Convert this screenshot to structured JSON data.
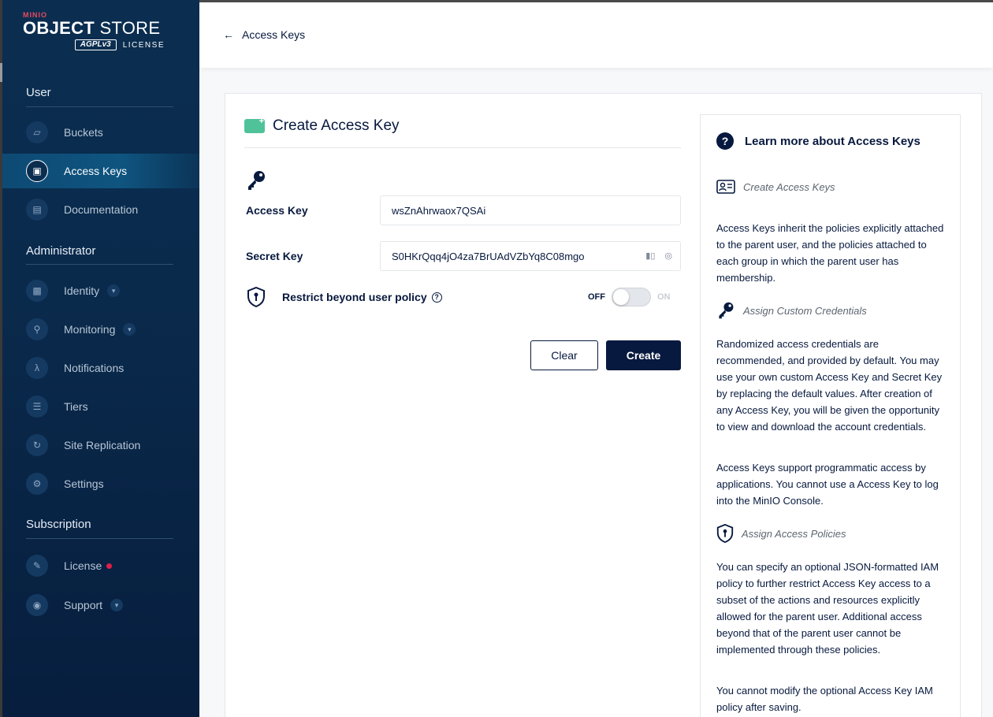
{
  "brand": {
    "minio": "MINIO",
    "store_bold": "OBJECT",
    "store_rest": " STORE",
    "agpl": "AGPLv3",
    "license": "LICENSE"
  },
  "sidebar": {
    "sections": [
      "User",
      "Administrator",
      "Subscription"
    ],
    "user_items": [
      {
        "label": "Buckets",
        "icon": "bucket-icon"
      },
      {
        "label": "Access Keys",
        "icon": "access-key-icon",
        "active": true
      },
      {
        "label": "Documentation",
        "icon": "document-icon"
      }
    ],
    "admin_items": [
      {
        "label": "Identity",
        "icon": "identity-icon",
        "expandable": true
      },
      {
        "label": "Monitoring",
        "icon": "monitoring-icon",
        "expandable": true
      },
      {
        "label": "Notifications",
        "icon": "lambda-icon"
      },
      {
        "label": "Tiers",
        "icon": "tiers-icon"
      },
      {
        "label": "Site Replication",
        "icon": "replication-icon"
      },
      {
        "label": "Settings",
        "icon": "settings-icon"
      }
    ],
    "subscription_items": [
      {
        "label": "License",
        "icon": "license-icon",
        "badge": true
      },
      {
        "label": "Support",
        "icon": "support-icon",
        "expandable": true
      }
    ]
  },
  "header": {
    "back_label": "Access Keys"
  },
  "form": {
    "title": "Create Access Key",
    "access_key_label": "Access Key",
    "access_key_value": "wsZnAhrwaox7QSAi",
    "secret_key_label": "Secret Key",
    "secret_key_value": "S0HKrQqq4jO4za7BrUAdVZbYq8C08mgo",
    "restrict_label": "Restrict beyond user policy",
    "toggle_off": "OFF",
    "toggle_on": "ON",
    "toggle_state": false,
    "clear_label": "Clear",
    "create_label": "Create"
  },
  "help": {
    "title": "Learn more about Access Keys",
    "sections": [
      {
        "heading": "Create Access Keys",
        "paragraphs": [
          "Access Keys inherit the policies explicitly attached to the parent user, and the policies attached to each group in which the parent user has membership."
        ]
      },
      {
        "heading": "Assign Custom Credentials",
        "paragraphs": [
          "Randomized access credentials are recommended, and provided by default. You may use your own custom Access Key and Secret Key by replacing the default values. After creation of any Access Key, you will be given the opportunity to view and download the account credentials.",
          "Access Keys support programmatic access by applications. You cannot use a Access Key to log into the MinIO Console."
        ]
      },
      {
        "heading": "Assign Access Policies",
        "paragraphs": [
          "You can specify an optional JSON-formatted IAM policy to further restrict Access Key access to a subset of the actions and resources explicitly allowed for the parent user. Additional access beyond that of the parent user cannot be implemented through these policies.",
          "You cannot modify the optional Access Key IAM policy after saving."
        ]
      }
    ]
  },
  "colors": {
    "sidebar_bg": "#0b2e50",
    "primary": "#07193e",
    "accent_green": "#4fc29a",
    "badge_red": "#e01e4a"
  }
}
